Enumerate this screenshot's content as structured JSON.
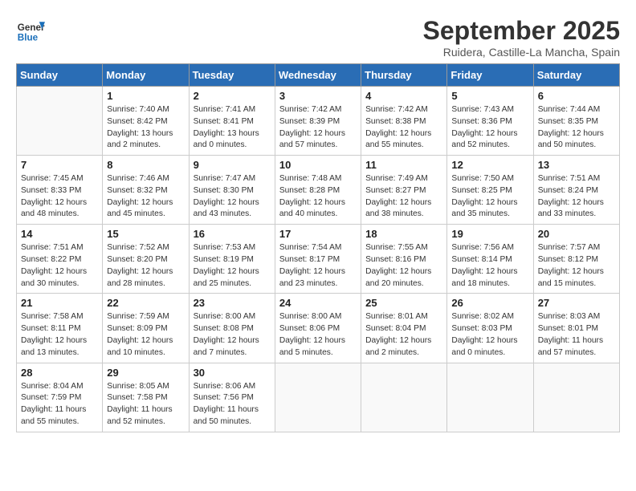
{
  "logo": {
    "line1": "General",
    "line2": "Blue"
  },
  "title": "September 2025",
  "subtitle": "Ruidera, Castille-La Mancha, Spain",
  "days_of_week": [
    "Sunday",
    "Monday",
    "Tuesday",
    "Wednesday",
    "Thursday",
    "Friday",
    "Saturday"
  ],
  "weeks": [
    [
      {
        "num": "",
        "empty": true
      },
      {
        "num": "1",
        "sunrise": "7:40 AM",
        "sunset": "8:42 PM",
        "daylight": "13 hours and 2 minutes."
      },
      {
        "num": "2",
        "sunrise": "7:41 AM",
        "sunset": "8:41 PM",
        "daylight": "13 hours and 0 minutes."
      },
      {
        "num": "3",
        "sunrise": "7:42 AM",
        "sunset": "8:39 PM",
        "daylight": "12 hours and 57 minutes."
      },
      {
        "num": "4",
        "sunrise": "7:42 AM",
        "sunset": "8:38 PM",
        "daylight": "12 hours and 55 minutes."
      },
      {
        "num": "5",
        "sunrise": "7:43 AM",
        "sunset": "8:36 PM",
        "daylight": "12 hours and 52 minutes."
      },
      {
        "num": "6",
        "sunrise": "7:44 AM",
        "sunset": "8:35 PM",
        "daylight": "12 hours and 50 minutes."
      }
    ],
    [
      {
        "num": "7",
        "sunrise": "7:45 AM",
        "sunset": "8:33 PM",
        "daylight": "12 hours and 48 minutes."
      },
      {
        "num": "8",
        "sunrise": "7:46 AM",
        "sunset": "8:32 PM",
        "daylight": "12 hours and 45 minutes."
      },
      {
        "num": "9",
        "sunrise": "7:47 AM",
        "sunset": "8:30 PM",
        "daylight": "12 hours and 43 minutes."
      },
      {
        "num": "10",
        "sunrise": "7:48 AM",
        "sunset": "8:28 PM",
        "daylight": "12 hours and 40 minutes."
      },
      {
        "num": "11",
        "sunrise": "7:49 AM",
        "sunset": "8:27 PM",
        "daylight": "12 hours and 38 minutes."
      },
      {
        "num": "12",
        "sunrise": "7:50 AM",
        "sunset": "8:25 PM",
        "daylight": "12 hours and 35 minutes."
      },
      {
        "num": "13",
        "sunrise": "7:51 AM",
        "sunset": "8:24 PM",
        "daylight": "12 hours and 33 minutes."
      }
    ],
    [
      {
        "num": "14",
        "sunrise": "7:51 AM",
        "sunset": "8:22 PM",
        "daylight": "12 hours and 30 minutes."
      },
      {
        "num": "15",
        "sunrise": "7:52 AM",
        "sunset": "8:20 PM",
        "daylight": "12 hours and 28 minutes."
      },
      {
        "num": "16",
        "sunrise": "7:53 AM",
        "sunset": "8:19 PM",
        "daylight": "12 hours and 25 minutes."
      },
      {
        "num": "17",
        "sunrise": "7:54 AM",
        "sunset": "8:17 PM",
        "daylight": "12 hours and 23 minutes."
      },
      {
        "num": "18",
        "sunrise": "7:55 AM",
        "sunset": "8:16 PM",
        "daylight": "12 hours and 20 minutes."
      },
      {
        "num": "19",
        "sunrise": "7:56 AM",
        "sunset": "8:14 PM",
        "daylight": "12 hours and 18 minutes."
      },
      {
        "num": "20",
        "sunrise": "7:57 AM",
        "sunset": "8:12 PM",
        "daylight": "12 hours and 15 minutes."
      }
    ],
    [
      {
        "num": "21",
        "sunrise": "7:58 AM",
        "sunset": "8:11 PM",
        "daylight": "12 hours and 13 minutes."
      },
      {
        "num": "22",
        "sunrise": "7:59 AM",
        "sunset": "8:09 PM",
        "daylight": "12 hours and 10 minutes."
      },
      {
        "num": "23",
        "sunrise": "8:00 AM",
        "sunset": "8:08 PM",
        "daylight": "12 hours and 7 minutes."
      },
      {
        "num": "24",
        "sunrise": "8:00 AM",
        "sunset": "8:06 PM",
        "daylight": "12 hours and 5 minutes."
      },
      {
        "num": "25",
        "sunrise": "8:01 AM",
        "sunset": "8:04 PM",
        "daylight": "12 hours and 2 minutes."
      },
      {
        "num": "26",
        "sunrise": "8:02 AM",
        "sunset": "8:03 PM",
        "daylight": "12 hours and 0 minutes."
      },
      {
        "num": "27",
        "sunrise": "8:03 AM",
        "sunset": "8:01 PM",
        "daylight": "11 hours and 57 minutes."
      }
    ],
    [
      {
        "num": "28",
        "sunrise": "8:04 AM",
        "sunset": "7:59 PM",
        "daylight": "11 hours and 55 minutes."
      },
      {
        "num": "29",
        "sunrise": "8:05 AM",
        "sunset": "7:58 PM",
        "daylight": "11 hours and 52 minutes."
      },
      {
        "num": "30",
        "sunrise": "8:06 AM",
        "sunset": "7:56 PM",
        "daylight": "11 hours and 50 minutes."
      },
      {
        "num": "",
        "empty": true
      },
      {
        "num": "",
        "empty": true
      },
      {
        "num": "",
        "empty": true
      },
      {
        "num": "",
        "empty": true
      }
    ]
  ]
}
